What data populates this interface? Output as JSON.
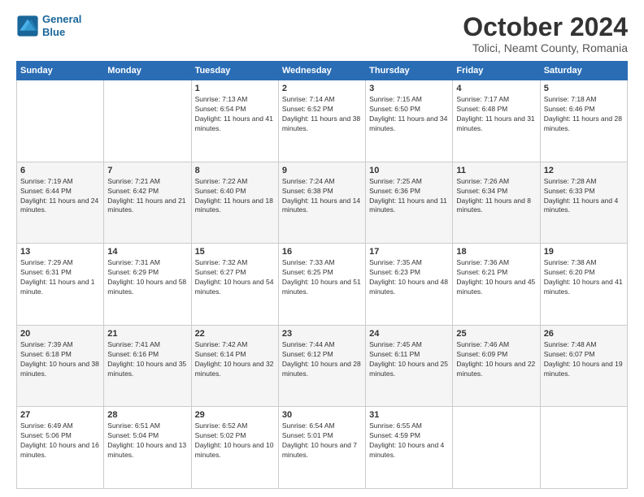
{
  "header": {
    "logo_line1": "General",
    "logo_line2": "Blue",
    "title": "October 2024",
    "subtitle": "Tolici, Neamt County, Romania"
  },
  "weekdays": [
    "Sunday",
    "Monday",
    "Tuesday",
    "Wednesday",
    "Thursday",
    "Friday",
    "Saturday"
  ],
  "weeks": [
    [
      {
        "day": "",
        "info": ""
      },
      {
        "day": "",
        "info": ""
      },
      {
        "day": "1",
        "info": "Sunrise: 7:13 AM\nSunset: 6:54 PM\nDaylight: 11 hours and 41 minutes."
      },
      {
        "day": "2",
        "info": "Sunrise: 7:14 AM\nSunset: 6:52 PM\nDaylight: 11 hours and 38 minutes."
      },
      {
        "day": "3",
        "info": "Sunrise: 7:15 AM\nSunset: 6:50 PM\nDaylight: 11 hours and 34 minutes."
      },
      {
        "day": "4",
        "info": "Sunrise: 7:17 AM\nSunset: 6:48 PM\nDaylight: 11 hours and 31 minutes."
      },
      {
        "day": "5",
        "info": "Sunrise: 7:18 AM\nSunset: 6:46 PM\nDaylight: 11 hours and 28 minutes."
      }
    ],
    [
      {
        "day": "6",
        "info": "Sunrise: 7:19 AM\nSunset: 6:44 PM\nDaylight: 11 hours and 24 minutes."
      },
      {
        "day": "7",
        "info": "Sunrise: 7:21 AM\nSunset: 6:42 PM\nDaylight: 11 hours and 21 minutes."
      },
      {
        "day": "8",
        "info": "Sunrise: 7:22 AM\nSunset: 6:40 PM\nDaylight: 11 hours and 18 minutes."
      },
      {
        "day": "9",
        "info": "Sunrise: 7:24 AM\nSunset: 6:38 PM\nDaylight: 11 hours and 14 minutes."
      },
      {
        "day": "10",
        "info": "Sunrise: 7:25 AM\nSunset: 6:36 PM\nDaylight: 11 hours and 11 minutes."
      },
      {
        "day": "11",
        "info": "Sunrise: 7:26 AM\nSunset: 6:34 PM\nDaylight: 11 hours and 8 minutes."
      },
      {
        "day": "12",
        "info": "Sunrise: 7:28 AM\nSunset: 6:33 PM\nDaylight: 11 hours and 4 minutes."
      }
    ],
    [
      {
        "day": "13",
        "info": "Sunrise: 7:29 AM\nSunset: 6:31 PM\nDaylight: 11 hours and 1 minute."
      },
      {
        "day": "14",
        "info": "Sunrise: 7:31 AM\nSunset: 6:29 PM\nDaylight: 10 hours and 58 minutes."
      },
      {
        "day": "15",
        "info": "Sunrise: 7:32 AM\nSunset: 6:27 PM\nDaylight: 10 hours and 54 minutes."
      },
      {
        "day": "16",
        "info": "Sunrise: 7:33 AM\nSunset: 6:25 PM\nDaylight: 10 hours and 51 minutes."
      },
      {
        "day": "17",
        "info": "Sunrise: 7:35 AM\nSunset: 6:23 PM\nDaylight: 10 hours and 48 minutes."
      },
      {
        "day": "18",
        "info": "Sunrise: 7:36 AM\nSunset: 6:21 PM\nDaylight: 10 hours and 45 minutes."
      },
      {
        "day": "19",
        "info": "Sunrise: 7:38 AM\nSunset: 6:20 PM\nDaylight: 10 hours and 41 minutes."
      }
    ],
    [
      {
        "day": "20",
        "info": "Sunrise: 7:39 AM\nSunset: 6:18 PM\nDaylight: 10 hours and 38 minutes."
      },
      {
        "day": "21",
        "info": "Sunrise: 7:41 AM\nSunset: 6:16 PM\nDaylight: 10 hours and 35 minutes."
      },
      {
        "day": "22",
        "info": "Sunrise: 7:42 AM\nSunset: 6:14 PM\nDaylight: 10 hours and 32 minutes."
      },
      {
        "day": "23",
        "info": "Sunrise: 7:44 AM\nSunset: 6:12 PM\nDaylight: 10 hours and 28 minutes."
      },
      {
        "day": "24",
        "info": "Sunrise: 7:45 AM\nSunset: 6:11 PM\nDaylight: 10 hours and 25 minutes."
      },
      {
        "day": "25",
        "info": "Sunrise: 7:46 AM\nSunset: 6:09 PM\nDaylight: 10 hours and 22 minutes."
      },
      {
        "day": "26",
        "info": "Sunrise: 7:48 AM\nSunset: 6:07 PM\nDaylight: 10 hours and 19 minutes."
      }
    ],
    [
      {
        "day": "27",
        "info": "Sunrise: 6:49 AM\nSunset: 5:06 PM\nDaylight: 10 hours and 16 minutes."
      },
      {
        "day": "28",
        "info": "Sunrise: 6:51 AM\nSunset: 5:04 PM\nDaylight: 10 hours and 13 minutes."
      },
      {
        "day": "29",
        "info": "Sunrise: 6:52 AM\nSunset: 5:02 PM\nDaylight: 10 hours and 10 minutes."
      },
      {
        "day": "30",
        "info": "Sunrise: 6:54 AM\nSunset: 5:01 PM\nDaylight: 10 hours and 7 minutes."
      },
      {
        "day": "31",
        "info": "Sunrise: 6:55 AM\nSunset: 4:59 PM\nDaylight: 10 hours and 4 minutes."
      },
      {
        "day": "",
        "info": ""
      },
      {
        "day": "",
        "info": ""
      }
    ]
  ]
}
